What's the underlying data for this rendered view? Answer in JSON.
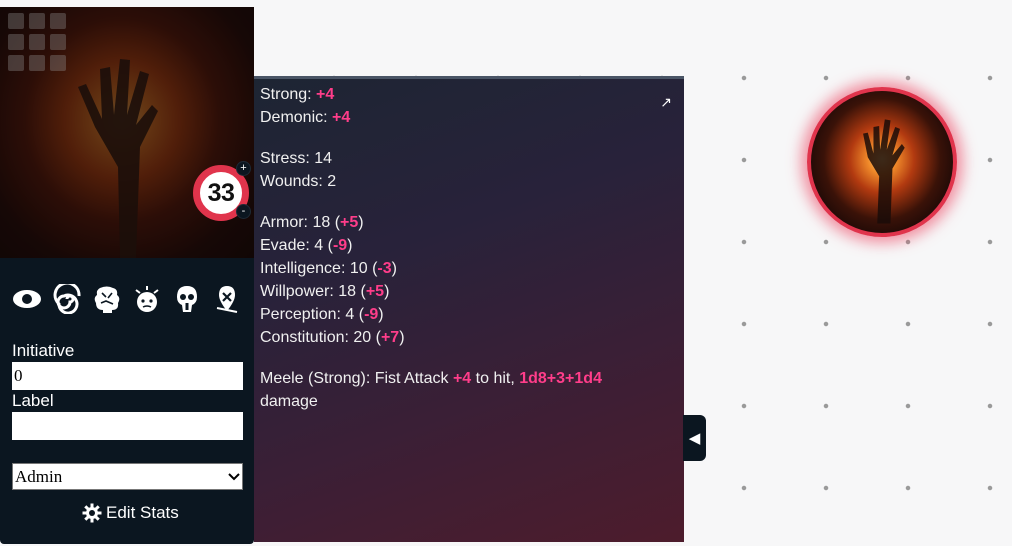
{
  "token": {
    "hp": "33",
    "hp_plus": "+",
    "hp_minus": "-"
  },
  "sidebar": {
    "initiative_label": "Initiative",
    "initiative_value": "0",
    "label_label": "Label",
    "label_value": "",
    "role_select": "Admin",
    "edit_stats": "Edit Stats",
    "icons": [
      "eye-icon",
      "spiral-icon",
      "brain-icon",
      "dazed-icon",
      "skull-icon",
      "pin-icon"
    ]
  },
  "stats": {
    "expand_glyph": "↗",
    "strong_label": "Strong:",
    "strong_value": "+4",
    "demonic_label": "Demonic:",
    "demonic_value": "+4",
    "stress": "Stress: 14",
    "wounds": "Wounds: 2",
    "armor_label": "Armor: 18 (",
    "armor_mod": "+5",
    "evade_label": "Evade: 4 (",
    "evade_mod": "-9",
    "intelligence_label": "Intelligence: 10 (",
    "intelligence_mod": "-3",
    "willpower_label": "Willpower: 18 (",
    "willpower_mod": "+5",
    "perception_label": "Perception: 4 (",
    "perception_mod": "-9",
    "constitution_label": "Constitution: 20 (",
    "constitution_mod": "+7",
    "close_paren": ")",
    "attack_prefix": "Meele (Strong): Fist Attack ",
    "attack_bonus": "+4",
    "attack_mid": " to hit, ",
    "attack_damage": "1d8+3+1d4",
    "attack_suffix": "damage"
  },
  "collapse_glyph": "◀"
}
